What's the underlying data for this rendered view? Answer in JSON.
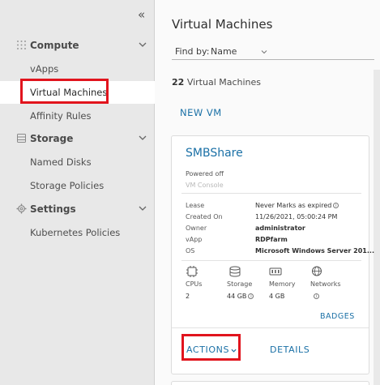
{
  "sidebar": {
    "collapse_icon": "«",
    "sections": [
      {
        "label": "Compute",
        "icon": "grid-dots-icon"
      },
      {
        "label": "Storage",
        "icon": "database-icon"
      },
      {
        "label": "Settings",
        "icon": "gear-icon"
      }
    ],
    "compute_items": [
      "vApps",
      "Virtual Machines",
      "Affinity Rules"
    ],
    "storage_items": [
      "Named Disks",
      "Storage Policies"
    ],
    "settings_items": [
      "Kubernetes Policies"
    ],
    "active_item": "Virtual Machines"
  },
  "main": {
    "title": "Virtual Machines",
    "find_by_label": "Find by:",
    "find_by_value": "Name",
    "count_number": "22",
    "count_text": "Virtual Machines",
    "new_vm_label": "NEW VM"
  },
  "card": {
    "name": "SMBShare",
    "power_state": "Powered off",
    "console_label": "VM Console",
    "details": [
      {
        "key": "Lease",
        "value": "Never Marks as expired"
      },
      {
        "key": "Created On",
        "value": "11/26/2021, 05:00:24 PM"
      },
      {
        "key": "Owner",
        "value": "administrator"
      },
      {
        "key": "vApp",
        "value": "RDPfarm"
      },
      {
        "key": "OS",
        "value": "Microsoft Windows Server 201..."
      }
    ],
    "resources": [
      {
        "label": "CPUs",
        "value": "2",
        "icon": "cpu-icon"
      },
      {
        "label": "Storage",
        "value": "44 GB",
        "icon": "storage-icon"
      },
      {
        "label": "Memory",
        "value": "4 GB",
        "icon": "memory-icon"
      },
      {
        "label": "Networks",
        "value": "",
        "icon": "network-icon"
      }
    ],
    "badges_label": "BADGES",
    "actions_label": "ACTIONS",
    "details_label": "DETAILS"
  },
  "colors": {
    "accent": "#1a70a6",
    "highlight": "#e1141d",
    "sidebar_bg": "#e8e8e8"
  }
}
